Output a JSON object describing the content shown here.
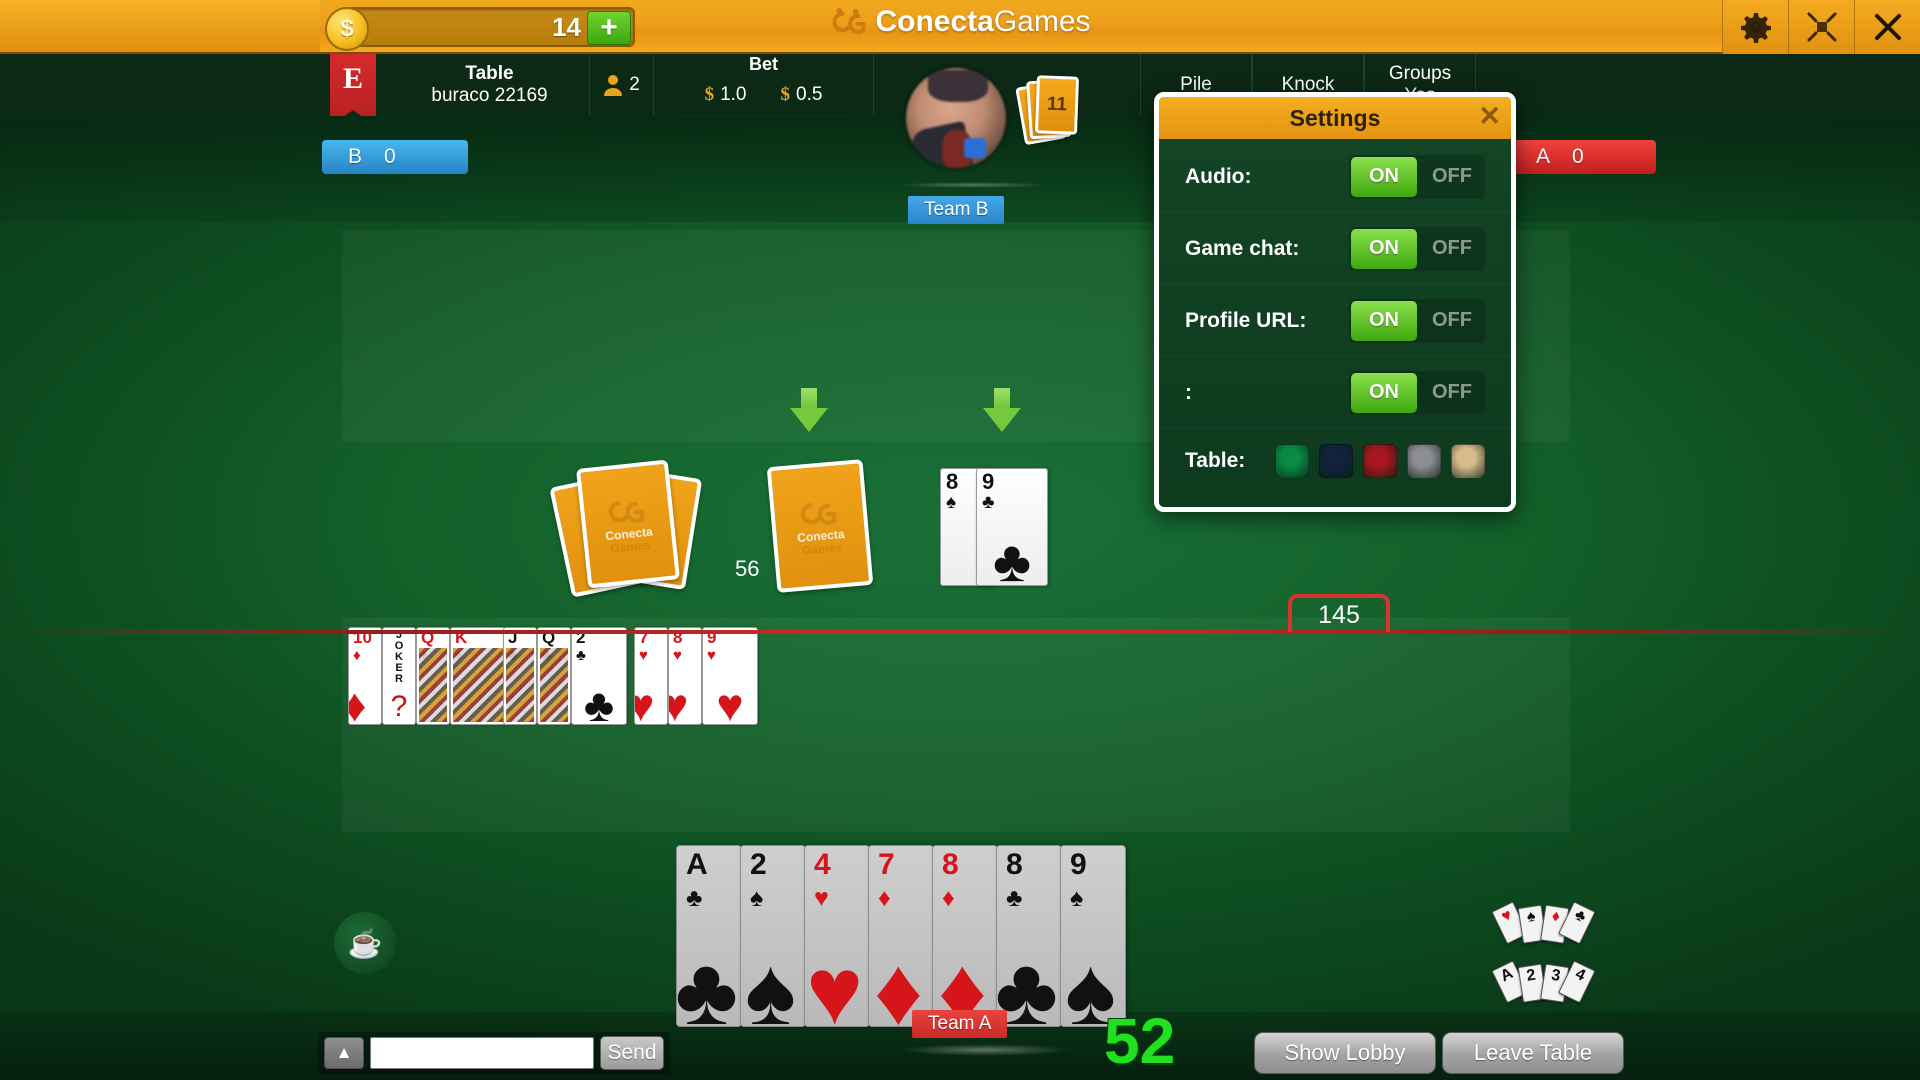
{
  "topbar": {
    "coin_icon": "dollar-coin-icon",
    "coin_amount": "14",
    "plus_label": "+",
    "brand_bold": "Conecta",
    "brand_light": "Games",
    "buttons": [
      {
        "name": "settings",
        "icon": "gear-icon"
      },
      {
        "name": "fullscreen",
        "icon": "fullscreen-icon"
      },
      {
        "name": "close",
        "icon": "close-icon"
      }
    ]
  },
  "infobar": {
    "flag_letter": "E",
    "table_label": "Table",
    "table_name": "buraco 22169",
    "players_icon": "person-icon",
    "players_count": "2",
    "bet_label": "Bet",
    "bet_currency": "$",
    "bet_value": "1.0",
    "fee_currency": "$",
    "fee_value": "0.5",
    "tabs": [
      {
        "label": "Pile",
        "sub": ""
      },
      {
        "label": "Knock",
        "sub": ""
      },
      {
        "label": "Groups",
        "sub": "Yes"
      }
    ]
  },
  "scores": {
    "team_b_label": "B",
    "team_b_score": "0",
    "team_a_label": "A",
    "team_a_score": "0",
    "team_b_color": "#2584c6",
    "team_a_color": "#c21f1d"
  },
  "table": {
    "opponent_team_badge": "Team B",
    "opponent_hand_count": "11",
    "player_team_badge": "Team A",
    "deck_count": "56",
    "target_score_marker": "145",
    "hand_points": "52",
    "coffee_icon": "coffee-cup-icon",
    "arrow_icon": "down-arrow-icon",
    "card_back_brand_top": "Conecta",
    "card_back_brand_bottom": "Games"
  },
  "discard_pile": [
    {
      "rank": "8",
      "suit": "♠",
      "color": "black"
    },
    {
      "rank": "9",
      "suit": "♣",
      "color": "black"
    }
  ],
  "melds": [
    {
      "name": "meld-diamonds",
      "cards": [
        {
          "rank": "10",
          "suit": "♦",
          "color": "red",
          "type": "pip"
        },
        {
          "rank": "JOKER",
          "suit": "",
          "color": "black",
          "type": "joker"
        },
        {
          "rank": "Q",
          "suit": "♦",
          "color": "red",
          "type": "face"
        },
        {
          "rank": "K",
          "suit": "♦",
          "color": "red",
          "type": "face"
        }
      ]
    },
    {
      "name": "meld-clubs",
      "cards": [
        {
          "rank": "J",
          "suit": "♣",
          "color": "black",
          "type": "face"
        },
        {
          "rank": "Q",
          "suit": "♣",
          "color": "black",
          "type": "face"
        },
        {
          "rank": "2",
          "suit": "♣",
          "color": "black",
          "type": "pip"
        }
      ]
    },
    {
      "name": "meld-hearts",
      "cards": [
        {
          "rank": "7",
          "suit": "♥",
          "color": "red",
          "type": "pip"
        },
        {
          "rank": "8",
          "suit": "♥",
          "color": "red",
          "type": "pip"
        },
        {
          "rank": "9",
          "suit": "♥",
          "color": "red",
          "type": "pip"
        }
      ]
    }
  ],
  "hand": [
    {
      "rank": "A",
      "suit": "♣",
      "color": "black"
    },
    {
      "rank": "2",
      "suit": "♠",
      "color": "black"
    },
    {
      "rank": "4",
      "suit": "♥",
      "color": "red"
    },
    {
      "rank": "7",
      "suit": "♦",
      "color": "red"
    },
    {
      "rank": "8",
      "suit": "♦",
      "color": "red"
    },
    {
      "rank": "8",
      "suit": "♣",
      "color": "black"
    },
    {
      "rank": "9",
      "suit": "♠",
      "color": "black"
    }
  ],
  "helpers": {
    "suits_icon": "sort-by-suit-icon",
    "suits_fan": [
      "♥",
      "♠",
      "♦",
      "♣"
    ],
    "sequence_icon": "sort-by-rank-icon",
    "sequence_fan": [
      "A",
      "2",
      "3",
      "4"
    ]
  },
  "chat": {
    "toggle_icon": "chevron-up-icon",
    "input_value": "",
    "input_placeholder": "",
    "send_label": "Send"
  },
  "footer": {
    "show_lobby": "Show Lobby",
    "leave_table": "Leave Table"
  },
  "settings_dialog": {
    "title": "Settings",
    "close_label": "✕",
    "rows": [
      {
        "label": "Audio:",
        "on": "ON",
        "off": "OFF",
        "state": "on"
      },
      {
        "label": "Game chat:",
        "on": "ON",
        "off": "OFF",
        "state": "on"
      },
      {
        "label": "Profile URL:",
        "on": "ON",
        "off": "OFF",
        "state": "on"
      },
      {
        "label": ":",
        "on": "ON",
        "off": "OFF",
        "state": "on"
      }
    ],
    "table_label": "Table:",
    "table_colors": [
      "#0b8a44",
      "#12223e",
      "#a81620",
      "#8d8d92",
      "#d9bb8a"
    ]
  }
}
